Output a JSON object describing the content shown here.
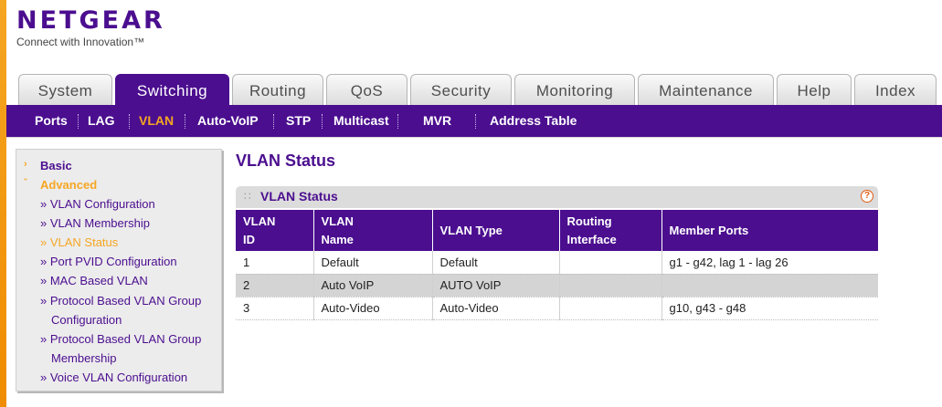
{
  "brand": {
    "name": "NETGEAR",
    "tagline": "Connect with Innovation™"
  },
  "tabs": [
    {
      "label": "System",
      "active": false
    },
    {
      "label": "Switching",
      "active": true
    },
    {
      "label": "Routing",
      "active": false
    },
    {
      "label": "QoS",
      "active": false
    },
    {
      "label": "Security",
      "active": false
    },
    {
      "label": "Monitoring",
      "active": false
    },
    {
      "label": "Maintenance",
      "active": false
    },
    {
      "label": "Help",
      "active": false
    },
    {
      "label": "Index",
      "active": false
    }
  ],
  "subnav": [
    {
      "label": "Ports",
      "active": false
    },
    {
      "label": "LAG",
      "active": false
    },
    {
      "label": "VLAN",
      "active": true
    },
    {
      "label": "Auto-VoIP",
      "active": false
    },
    {
      "label": "STP",
      "active": false
    },
    {
      "label": "Multicast",
      "active": false
    },
    {
      "label": "MVR",
      "active": false
    },
    {
      "label": "Address Table",
      "active": false
    }
  ],
  "sidebar": {
    "basic": "Basic",
    "advanced": "Advanced",
    "items": [
      {
        "label": "» VLAN Configuration",
        "active": false
      },
      {
        "label": "» VLAN Membership",
        "active": false
      },
      {
        "label": "» VLAN Status",
        "active": true
      },
      {
        "label": "» Port PVID Configuration",
        "active": false
      },
      {
        "label": "» MAC Based VLAN",
        "active": false
      },
      {
        "label": "» Protocol Based VLAN Group",
        "active": false
      },
      {
        "label": "Configuration",
        "active": false
      },
      {
        "label": "» Protocol Based VLAN Group",
        "active": false
      },
      {
        "label": "Membership",
        "active": false
      },
      {
        "label": "» Voice VLAN Configuration",
        "active": false
      }
    ]
  },
  "page": {
    "title": "VLAN Status",
    "panel_title": "VLAN Status",
    "help": "?"
  },
  "table": {
    "headers": [
      {
        "line1": "VLAN",
        "line2": "ID"
      },
      {
        "line1": "VLAN",
        "line2": "Name"
      },
      {
        "line1": "VLAN Type",
        "line2": ""
      },
      {
        "line1": "Routing",
        "line2": "Interface"
      },
      {
        "line1": "Member Ports",
        "line2": ""
      }
    ],
    "rows": [
      [
        "1",
        "Default",
        "Default",
        "",
        "g1 - g42, lag 1 - lag 26"
      ],
      [
        "2",
        "Auto VoIP",
        "AUTO VoIP",
        "",
        ""
      ],
      [
        "3",
        "Auto-Video",
        "Auto-Video",
        "",
        "g10, g43 - g48"
      ]
    ]
  },
  "colors": {
    "brand_purple": "#4b0e8f",
    "accent_orange": "#f5a623",
    "help_red": "#e05a10"
  }
}
